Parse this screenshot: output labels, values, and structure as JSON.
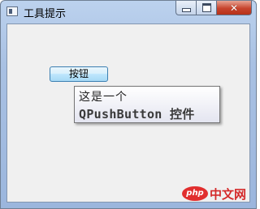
{
  "window": {
    "title": "工具提示",
    "controls": {
      "minimize_icon": "minimize-icon",
      "maximize_icon": "maximize-icon",
      "close_icon": "close-icon",
      "close_glyph": "✕"
    }
  },
  "main": {
    "button_label": "按钮",
    "tooltip": {
      "line1": "这是一个",
      "line2": "QPushButton 控件"
    }
  },
  "watermark": {
    "logo": "php",
    "text": "中文网"
  }
}
